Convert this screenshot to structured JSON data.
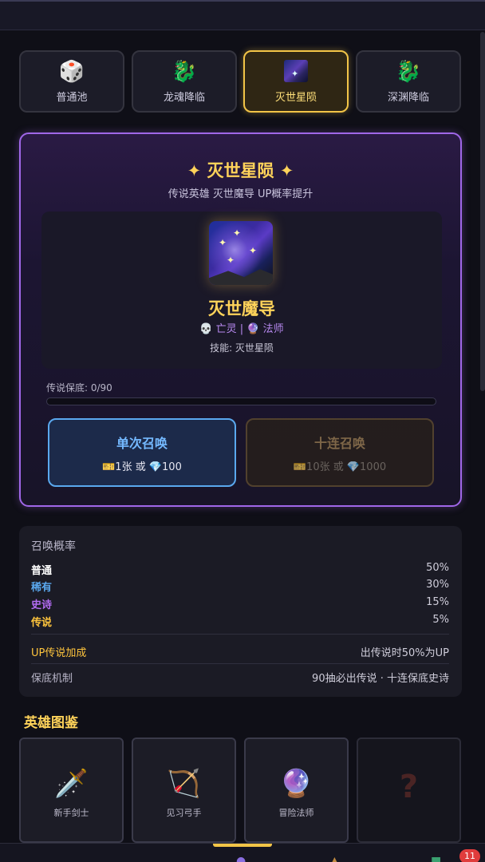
{
  "tabs": [
    {
      "label": "普通池",
      "icon": "dice-icon",
      "glyph": "🎲",
      "active": false
    },
    {
      "label": "龙魂降临",
      "icon": "dragon-icon",
      "glyph": "🐉",
      "active": false
    },
    {
      "label": "灭世星陨",
      "icon": "starfall-icon",
      "glyph": "",
      "active": true
    },
    {
      "label": "深渊降临",
      "icon": "dragon-icon",
      "glyph": "🐉",
      "active": false
    }
  ],
  "banner": {
    "title": "✦ 灭世星陨 ✦",
    "subtitle": "传说英雄 灭世魔导 UP概率提升",
    "hero_name": "灭世魔导",
    "hero_tags": "💀 亡灵 | 🔮 法师",
    "hero_skill": "技能: 灭世星陨",
    "pity_label": "传说保底: 0/90",
    "pity_progress": 0,
    "single_title": "单次召唤",
    "single_cost": "🎫1张 或 💎100",
    "ten_title": "十连召唤",
    "ten_cost": "🎫10张 或 💎1000"
  },
  "rates": {
    "title": "召唤概率",
    "rows": [
      {
        "name": "普通",
        "value": "50%",
        "color": "#ffffff"
      },
      {
        "name": "稀有",
        "value": "30%",
        "color": "#5aa8ee"
      },
      {
        "name": "史诗",
        "value": "15%",
        "color": "#b36cf2"
      },
      {
        "name": "传说",
        "value": "5%",
        "color": "#ffc53d"
      }
    ],
    "up_label": "UP传说加成",
    "up_value": "出传说时50%为UP",
    "pity_rule_label": "保底机制",
    "pity_rule_value": "90抽必出传说 · 十连保底史诗"
  },
  "collection": {
    "title": "英雄图鉴",
    "cards": [
      {
        "name": "新手剑士",
        "icon": "sword-icon",
        "glyph": "🗡️"
      },
      {
        "name": "见习弓手",
        "icon": "bow-icon",
        "glyph": "🏹"
      },
      {
        "name": "冒险法师",
        "icon": "crystal-ball-icon",
        "glyph": "🔮"
      },
      {
        "name": "",
        "icon": "question-icon",
        "glyph": "?"
      }
    ]
  },
  "nav": {
    "badge_count": "11"
  }
}
